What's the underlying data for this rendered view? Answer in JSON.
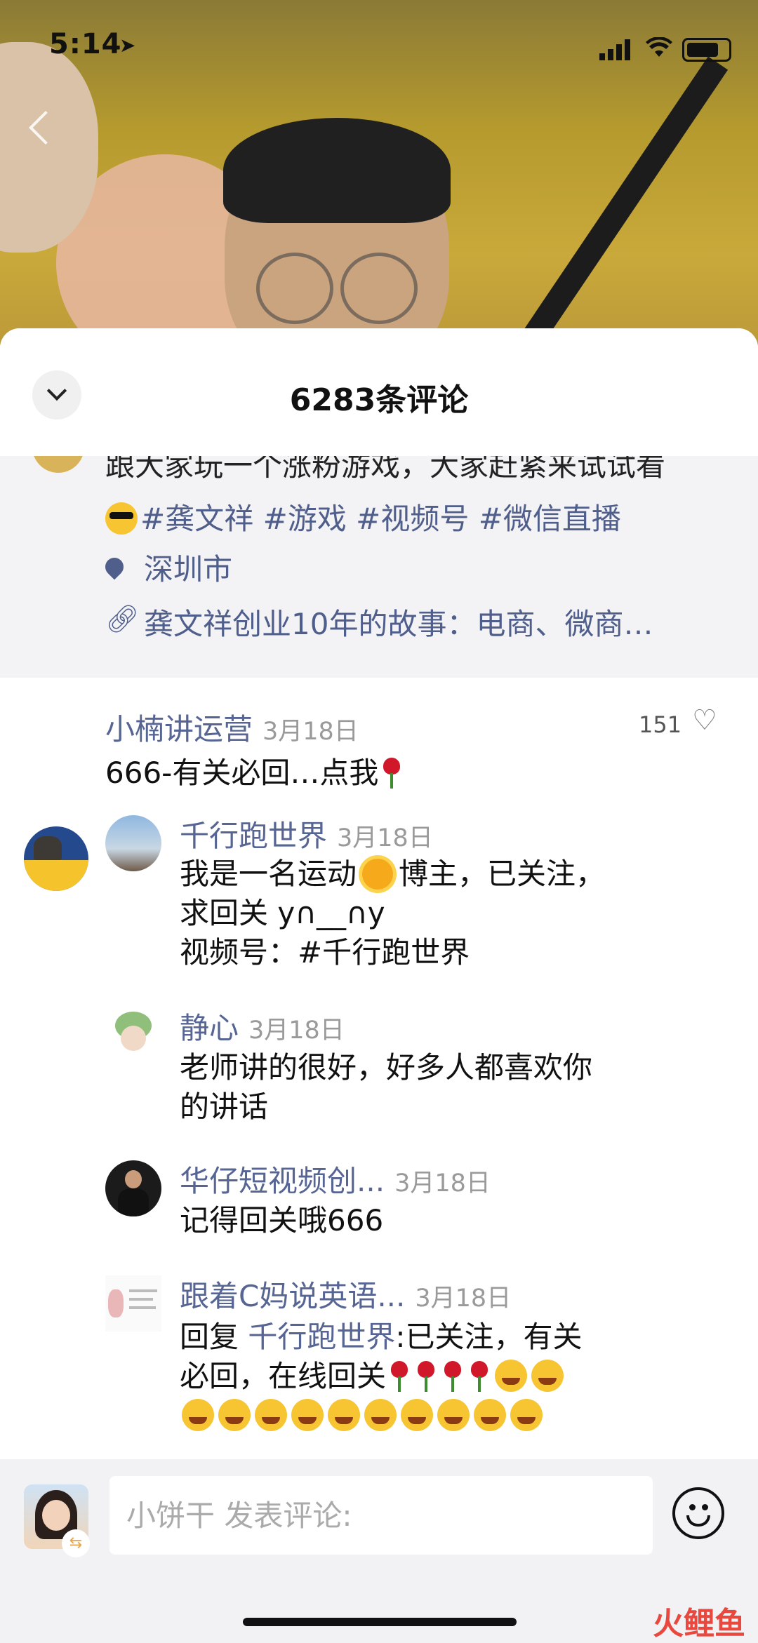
{
  "status": {
    "time": "5:14",
    "location_icon": "location-arrow-icon",
    "signal_icon": "signal-icon",
    "wifi_icon": "wifi-icon",
    "battery_icon": "battery-icon"
  },
  "sheet": {
    "title": "6283条评论",
    "collapse_icon": "chevron-down-icon"
  },
  "post": {
    "line_cut": "跟大家玩一个涨粉游戏，大家赶紧来试试看",
    "tags": [
      "#龚文祥",
      "#游戏",
      "#视频号",
      "#微信直播"
    ],
    "location": "深圳市",
    "link": "龚文祥创业10年的故事：电商、微商…"
  },
  "comments": [
    {
      "name": "小楠讲运营",
      "date": "3月18日",
      "likes": "151",
      "text": "666-有关必回…点我"
    }
  ],
  "replies": [
    {
      "name": "千行跑世界",
      "date": "3月18日",
      "line1a": "我是一名运动",
      "line1b": "博主，已关注，",
      "line2": "求回关 y∩__∩y",
      "line3": "视频号：#千行跑世界"
    },
    {
      "name": "静心",
      "date": "3月18日",
      "line1": "老师讲的很好，好多人都喜欢你",
      "line2": "的讲话"
    },
    {
      "name": "华仔短视频创...",
      "date": "3月18日",
      "line1": "记得回关哦666"
    },
    {
      "name": "跟着C妈说英语...",
      "date": "3月18日",
      "reply_prefix": "回复",
      "reply_to": "千行跑世界",
      "line1_rest": ":已关注，有关",
      "line2": "必回，在线回关"
    }
  ],
  "input": {
    "user": "小饼干",
    "placeholder": "小饼干 发表评论:"
  },
  "watermark": "火鲤鱼"
}
